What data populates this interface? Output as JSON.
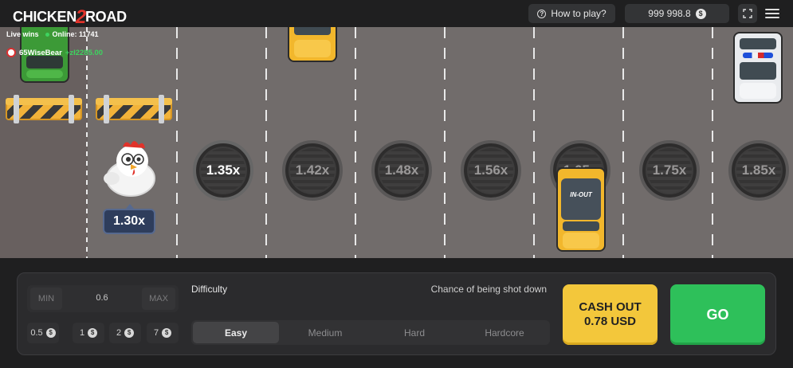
{
  "header": {
    "logo_left": "CHICKEN",
    "logo_num": "2",
    "logo_right": "ROAD",
    "how_to_play": "How to play?",
    "balance": "999 998.8",
    "currency_symbol": "$"
  },
  "live": {
    "label": "Live wins",
    "online": "Online: 11741",
    "winner_name": "65WiseBear",
    "winner_amount": "+zł2285.00"
  },
  "game": {
    "current_multiplier": "1.30x",
    "multipliers": [
      "1.35x",
      "1.42x",
      "1.48x",
      "1.56x",
      "1.65x",
      "1.75x",
      "1.85x"
    ],
    "truck_label": "IN-OUT"
  },
  "bet": {
    "min_label": "MIN",
    "max_label": "MAX",
    "value": "0.6",
    "chips": [
      "0.5",
      "1",
      "2",
      "7"
    ]
  },
  "difficulty": {
    "label": "Difficulty",
    "chance_label": "Chance of being shot down",
    "options": [
      "Easy",
      "Medium",
      "Hard",
      "Hardcore"
    ],
    "selected": "Easy"
  },
  "actions": {
    "cashout_line1": "CASH OUT",
    "cashout_line2": "0.78 USD",
    "go": "GO"
  },
  "colors": {
    "road": "#716c6b",
    "cashout": "#f3c73b",
    "go": "#2ec05a",
    "win_green": "#3ed35f"
  }
}
